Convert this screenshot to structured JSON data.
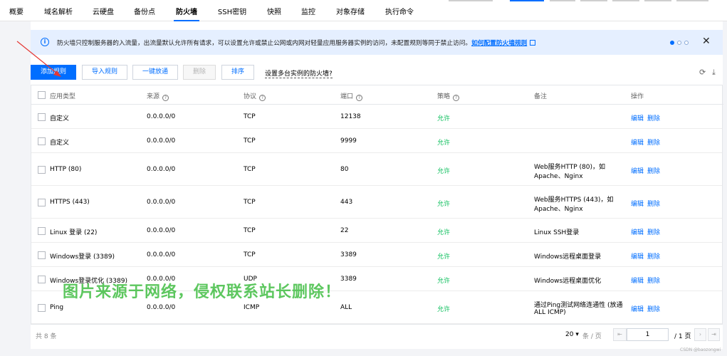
{
  "tabs": [
    {
      "label": "概要"
    },
    {
      "label": "域名解析"
    },
    {
      "label": "云硬盘"
    },
    {
      "label": "备份点"
    },
    {
      "label": "防火墙"
    },
    {
      "label": "SSH密钥"
    },
    {
      "label": "快照"
    },
    {
      "label": "监控"
    },
    {
      "label": "对象存储"
    },
    {
      "label": "执行命令"
    }
  ],
  "active_tab": "防火墙",
  "notice": {
    "text": "防火墙只控制服务器的入流量，出流量默认允许所有请求，可以设置允许或禁止公网或内网对轻量应用服务器实例的访问，未配置规则等同于禁止访问。",
    "link": "如何配置防火墙规则",
    "info_icon": "info-icon",
    "close_icon": "close-icon"
  },
  "toolbar": {
    "add": "添加规则",
    "import": "导入规则",
    "one_click": "一键放通",
    "delete": "删除",
    "sort": "排序",
    "multi_instance": "设置多台实例的防火墙?",
    "refresh_icon": "refresh-icon",
    "download_icon": "download-icon"
  },
  "table": {
    "headers": [
      "应用类型",
      "来源",
      "协议",
      "端口",
      "策略",
      "备注",
      "操作"
    ],
    "rows": [
      {
        "app": "自定义",
        "source": "0.0.0.0/0",
        "protocol": "TCP",
        "port": "12138",
        "policy": "允许",
        "note1": "",
        "note2": "",
        "edit": "编辑",
        "del": "删除"
      },
      {
        "app": "自定义",
        "source": "0.0.0.0/0",
        "protocol": "TCP",
        "port": "9999",
        "policy": "允许",
        "note1": "",
        "note2": "",
        "edit": "编辑",
        "del": "删除"
      },
      {
        "app": "HTTP (80)",
        "source": "0.0.0.0/0",
        "protocol": "TCP",
        "port": "80",
        "policy": "允许",
        "note1": "Web服务HTTP (80)，如",
        "note2": "Apache、Nginx",
        "edit": "编辑",
        "del": "删除"
      },
      {
        "app": "HTTPS (443)",
        "source": "0.0.0.0/0",
        "protocol": "TCP",
        "port": "443",
        "policy": "允许",
        "note1": "Web服务HTTPS (443)，如",
        "note2": "Apache、Nginx",
        "edit": "编辑",
        "del": "删除"
      },
      {
        "app": "Linux 登录 (22)",
        "source": "0.0.0.0/0",
        "protocol": "TCP",
        "port": "22",
        "policy": "允许",
        "note1": "Linux SSH登录",
        "note2": "",
        "edit": "编辑",
        "del": "删除"
      },
      {
        "app": "Windows登录 (3389)",
        "source": "0.0.0.0/0",
        "protocol": "TCP",
        "port": "3389",
        "policy": "允许",
        "note1": "Windows远程桌面登录",
        "note2": "",
        "edit": "编辑",
        "del": "删除"
      },
      {
        "app": "Windows登录优化 (3389)",
        "source": "0.0.0.0/0",
        "protocol": "UDP",
        "port": "3389",
        "policy": "允许",
        "note1": "Windows远程桌面优化",
        "note2": "",
        "edit": "编辑",
        "del": "删除"
      },
      {
        "app": "Ping",
        "source": "0.0.0.0/0",
        "protocol": "ICMP",
        "port": "ALL",
        "policy": "允许",
        "note1": "通过Ping测试网络连通性 (放通",
        "note2": "ALL ICMP)",
        "edit": "编辑",
        "del": "删除"
      }
    ]
  },
  "footer": {
    "total": "共 8 条",
    "page_size": "20",
    "per_page_label": "条 / 页",
    "page": "1",
    "page_total": "/ 1 页"
  },
  "watermark": "图片来源于网络，侵权联系站长删除！",
  "credit": "CSDN @baozongwi",
  "colors": {
    "accent": "#006eff",
    "allow": "#0abf5b",
    "notice_bg": "#e5efff",
    "watermark": "#27b52a"
  }
}
